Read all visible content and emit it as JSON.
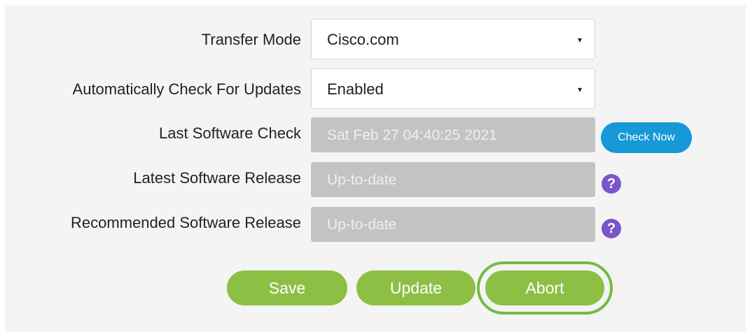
{
  "form": {
    "transfer_mode": {
      "label": "Transfer Mode",
      "value": "Cisco.com",
      "caret": "▾"
    },
    "auto_check": {
      "label": "Automatically Check For Updates",
      "value": "Enabled",
      "caret": "▾"
    },
    "last_check": {
      "label": "Last Software Check",
      "value": "Sat Feb 27 04:40:25 2021",
      "button": "Check Now"
    },
    "latest_release": {
      "label": "Latest Software Release",
      "value": "Up-to-date",
      "help": "?"
    },
    "recommended_release": {
      "label": "Recommended Software Release",
      "value": "Up-to-date",
      "help": "?"
    }
  },
  "actions": {
    "save": "Save",
    "update": "Update",
    "abort": "Abort"
  },
  "colors": {
    "panel_bg": "#f4f4f4",
    "readonly_bg": "#c3c3c3",
    "primary_blue": "#1699d6",
    "action_green": "#8dbf45",
    "highlight_ring": "#74bb44",
    "help_purple": "#7b55c9"
  }
}
